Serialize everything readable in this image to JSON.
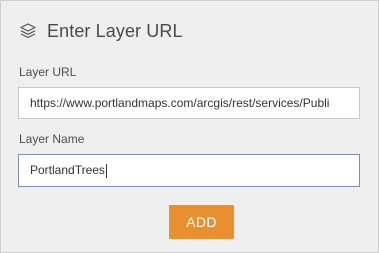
{
  "dialog": {
    "title": "Enter Layer URL",
    "icon": "layers-icon"
  },
  "layer_url": {
    "label": "Layer URL",
    "value": "https://www.portlandmaps.com/arcgis/rest/services/Publi"
  },
  "layer_name": {
    "label": "Layer Name",
    "value": "PortlandTrees"
  },
  "actions": {
    "add_label": "ADD"
  },
  "colors": {
    "accent": "#e8902f",
    "panel_background": "#efefef",
    "focused_border": "#7a8fb0"
  }
}
